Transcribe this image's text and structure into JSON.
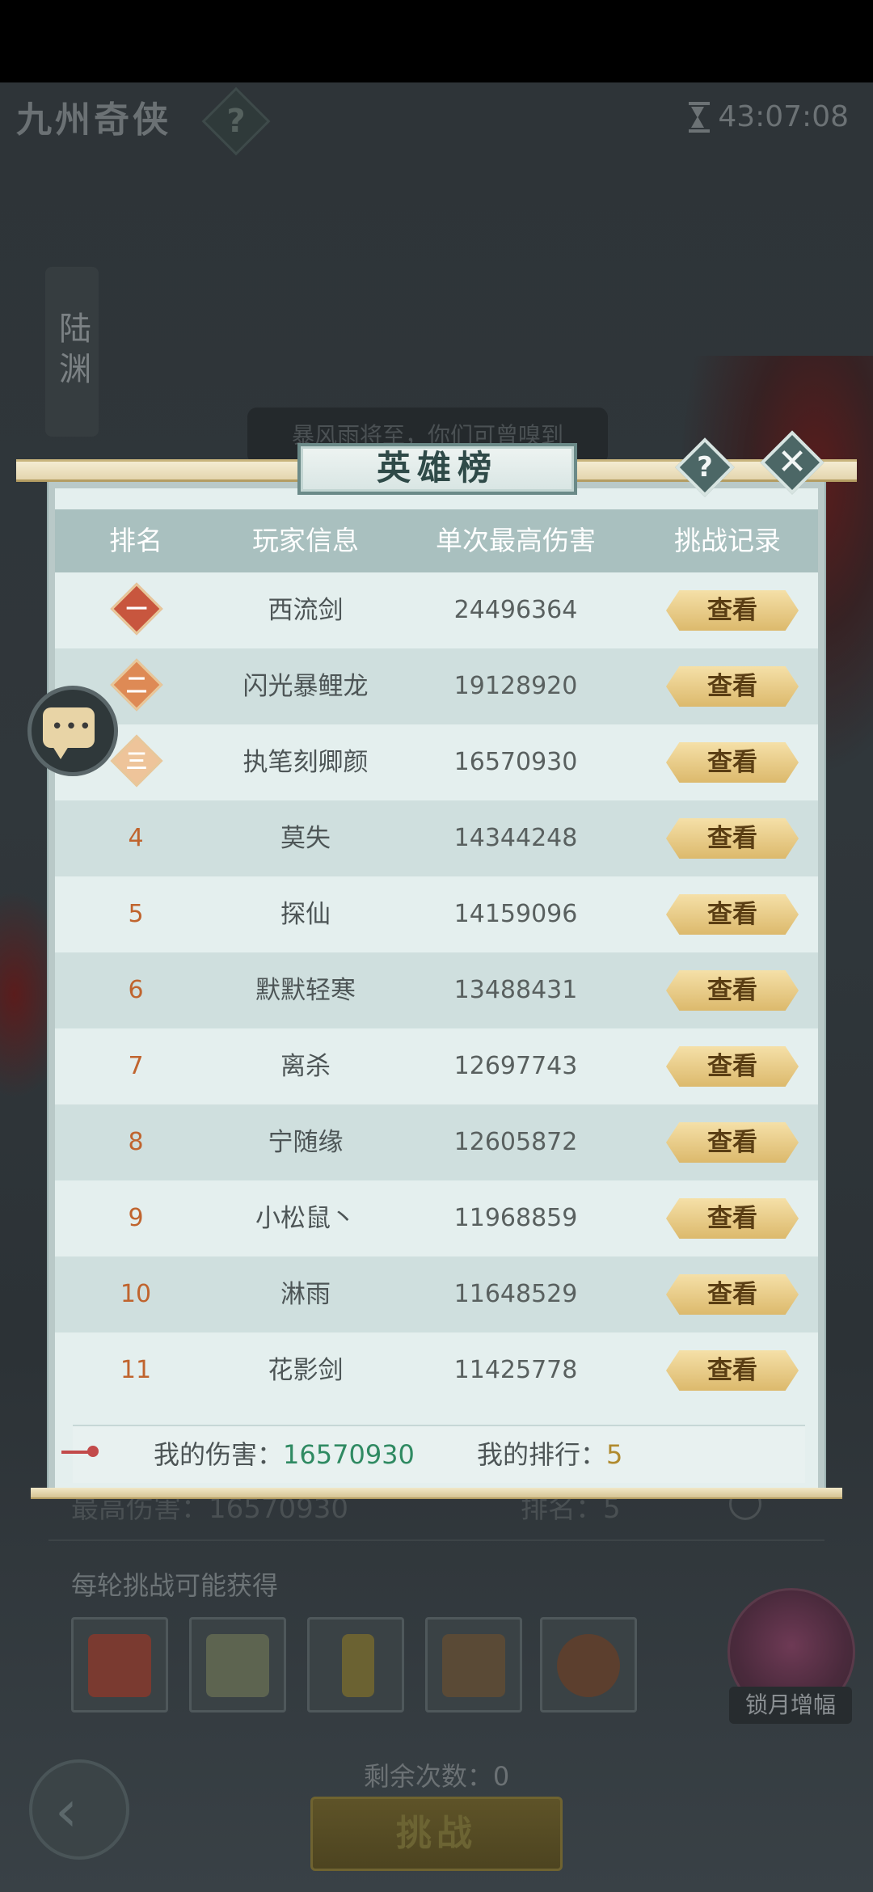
{
  "header": {
    "game_title": "九州奇侠",
    "help_icon": "?",
    "timer": "43:07:08"
  },
  "side_banner": "陆渊",
  "bg_notice": "暴风雨将至，你们可曾嗅到",
  "modal": {
    "title": "英雄榜",
    "help_icon": "?",
    "close_icon": "✕",
    "columns": [
      "排名",
      "玩家信息",
      "单次最高伤害",
      "挑战记录"
    ],
    "rows": [
      {
        "rank": "一",
        "name": "西流剑",
        "damage": "24496364",
        "action": "查看"
      },
      {
        "rank": "二",
        "name": "闪光暴鲤龙",
        "damage": "19128920",
        "action": "查看"
      },
      {
        "rank": "三",
        "name": "执笔刻卿颜",
        "damage": "16570930",
        "action": "查看"
      },
      {
        "rank": "4",
        "name": "莫失",
        "damage": "14344248",
        "action": "查看"
      },
      {
        "rank": "5",
        "name": "探仙",
        "damage": "14159096",
        "action": "查看"
      },
      {
        "rank": "6",
        "name": "默默轻寒",
        "damage": "13488431",
        "action": "查看"
      },
      {
        "rank": "7",
        "name": "离杀",
        "damage": "12697743",
        "action": "查看"
      },
      {
        "rank": "8",
        "name": "宁随缘",
        "damage": "12605872",
        "action": "查看"
      },
      {
        "rank": "9",
        "name": "小松鼠丶",
        "damage": "11968859",
        "action": "查看"
      },
      {
        "rank": "10",
        "name": "淋雨",
        "damage": "11648529",
        "action": "查看"
      },
      {
        "rank": "11",
        "name": "花影剑",
        "damage": "11425778",
        "action": "查看"
      }
    ],
    "my_damage_label": "我的伤害：",
    "my_damage_value": "16570930",
    "my_rank_label": "我的排行：",
    "my_rank_value": "5"
  },
  "bottom": {
    "best_damage": "最高伤害：16570930",
    "rank": "排名：5",
    "reward_title": "每轮挑战可能获得",
    "rewards": [
      "treasure-chest-icon",
      "scroll-fragment-icon",
      "jade-token-icon",
      "bronze-cauldron-icon",
      "copper-coin-icon"
    ],
    "moon_buff_label": "锁月增幅",
    "remaining": "剩余次数：0",
    "challenge_label": "挑战"
  },
  "colors": {
    "accent_gold": "#dcb96c",
    "rank_orange": "#c0642e",
    "my_damage_green": "#2f8a62",
    "my_rank_gold": "#b08a2e",
    "header_teal": "#a9c0bf"
  }
}
